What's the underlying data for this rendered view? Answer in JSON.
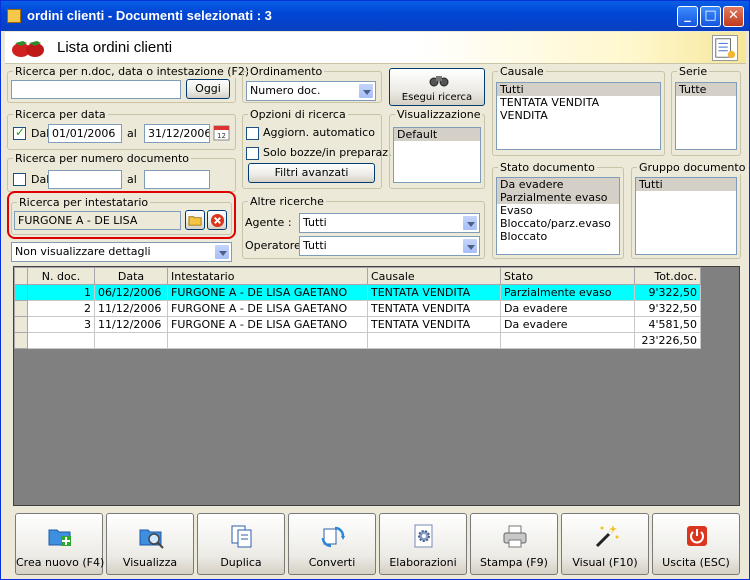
{
  "window": {
    "title": "ordini clienti - Documenti selezionati : 3"
  },
  "header": {
    "title": "Lista ordini clienti"
  },
  "search_doc": {
    "label": "Ricerca per n.doc, data o intestazione (F2)",
    "value": "",
    "button": "Oggi"
  },
  "ordinamento": {
    "label": "Ordinamento",
    "selected": "Numero doc."
  },
  "esegui": {
    "label": "Esegui ricerca"
  },
  "causale": {
    "label": "Causale",
    "items": [
      "Tutti",
      "TENTATA VENDITA",
      "VENDITA"
    ]
  },
  "serie": {
    "label": "Serie",
    "items": [
      "Tutte"
    ]
  },
  "search_date": {
    "label": "Ricerca per data",
    "dal_label": "Dal",
    "from": "01/01/2006",
    "al_label": "al",
    "to": "31/12/2006"
  },
  "opzioni": {
    "label": "Opzioni di ricerca",
    "aggiorn": "Aggiorn. automatico",
    "bozze": "Solo bozze/in preparaz.",
    "filtri": "Filtri avanzati"
  },
  "visualizzazione": {
    "label": "Visualizzazione",
    "items": [
      "Default"
    ]
  },
  "search_num": {
    "label": "Ricerca per numero documento",
    "dal_label": "Dal",
    "al_label": "al"
  },
  "stato": {
    "label": "Stato documento",
    "items": [
      "Da evadere",
      "Parzialmente evaso",
      "Evaso",
      "Bloccato/parz.evaso",
      "Bloccato"
    ]
  },
  "gruppo": {
    "label": "Gruppo documento",
    "items": [
      "Tutti"
    ]
  },
  "search_int": {
    "label": "Ricerca per intestatario",
    "value": "FURGONE A - DE LISA"
  },
  "altre": {
    "label": "Altre ricerche",
    "agente_label": "Agente :",
    "agente": "Tutti",
    "operatore_label": "Operatore :",
    "operatore": "Tutti"
  },
  "dettagli": {
    "selected": "Non visualizzare dettagli"
  },
  "grid": {
    "headers": [
      "N. doc.",
      "Data",
      "Intestatario",
      "Causale",
      "Stato",
      "Tot.doc."
    ],
    "rows": [
      [
        "1",
        "06/12/2006",
        "FURGONE A - DE LISA GAETANO",
        "TENTATA VENDITA",
        "Parzialmente evaso",
        "9'322,50"
      ],
      [
        "2",
        "11/12/2006",
        "FURGONE A - DE LISA GAETANO",
        "TENTATA VENDITA",
        "Da evadere",
        "9'322,50"
      ],
      [
        "3",
        "11/12/2006",
        "FURGONE A - DE LISA GAETANO",
        "TENTATA VENDITA",
        "Da evadere",
        "4'581,50"
      ]
    ],
    "total": "23'226,50"
  },
  "toolbar": {
    "crea": "Crea nuovo (F4)",
    "visualizza": "Visualizza",
    "duplica": "Duplica",
    "converti": "Converti",
    "elaborazioni": "Elaborazioni",
    "stampa": "Stampa (F9)",
    "visual": "Visual (F10)",
    "uscita": "Uscita (ESC)"
  }
}
